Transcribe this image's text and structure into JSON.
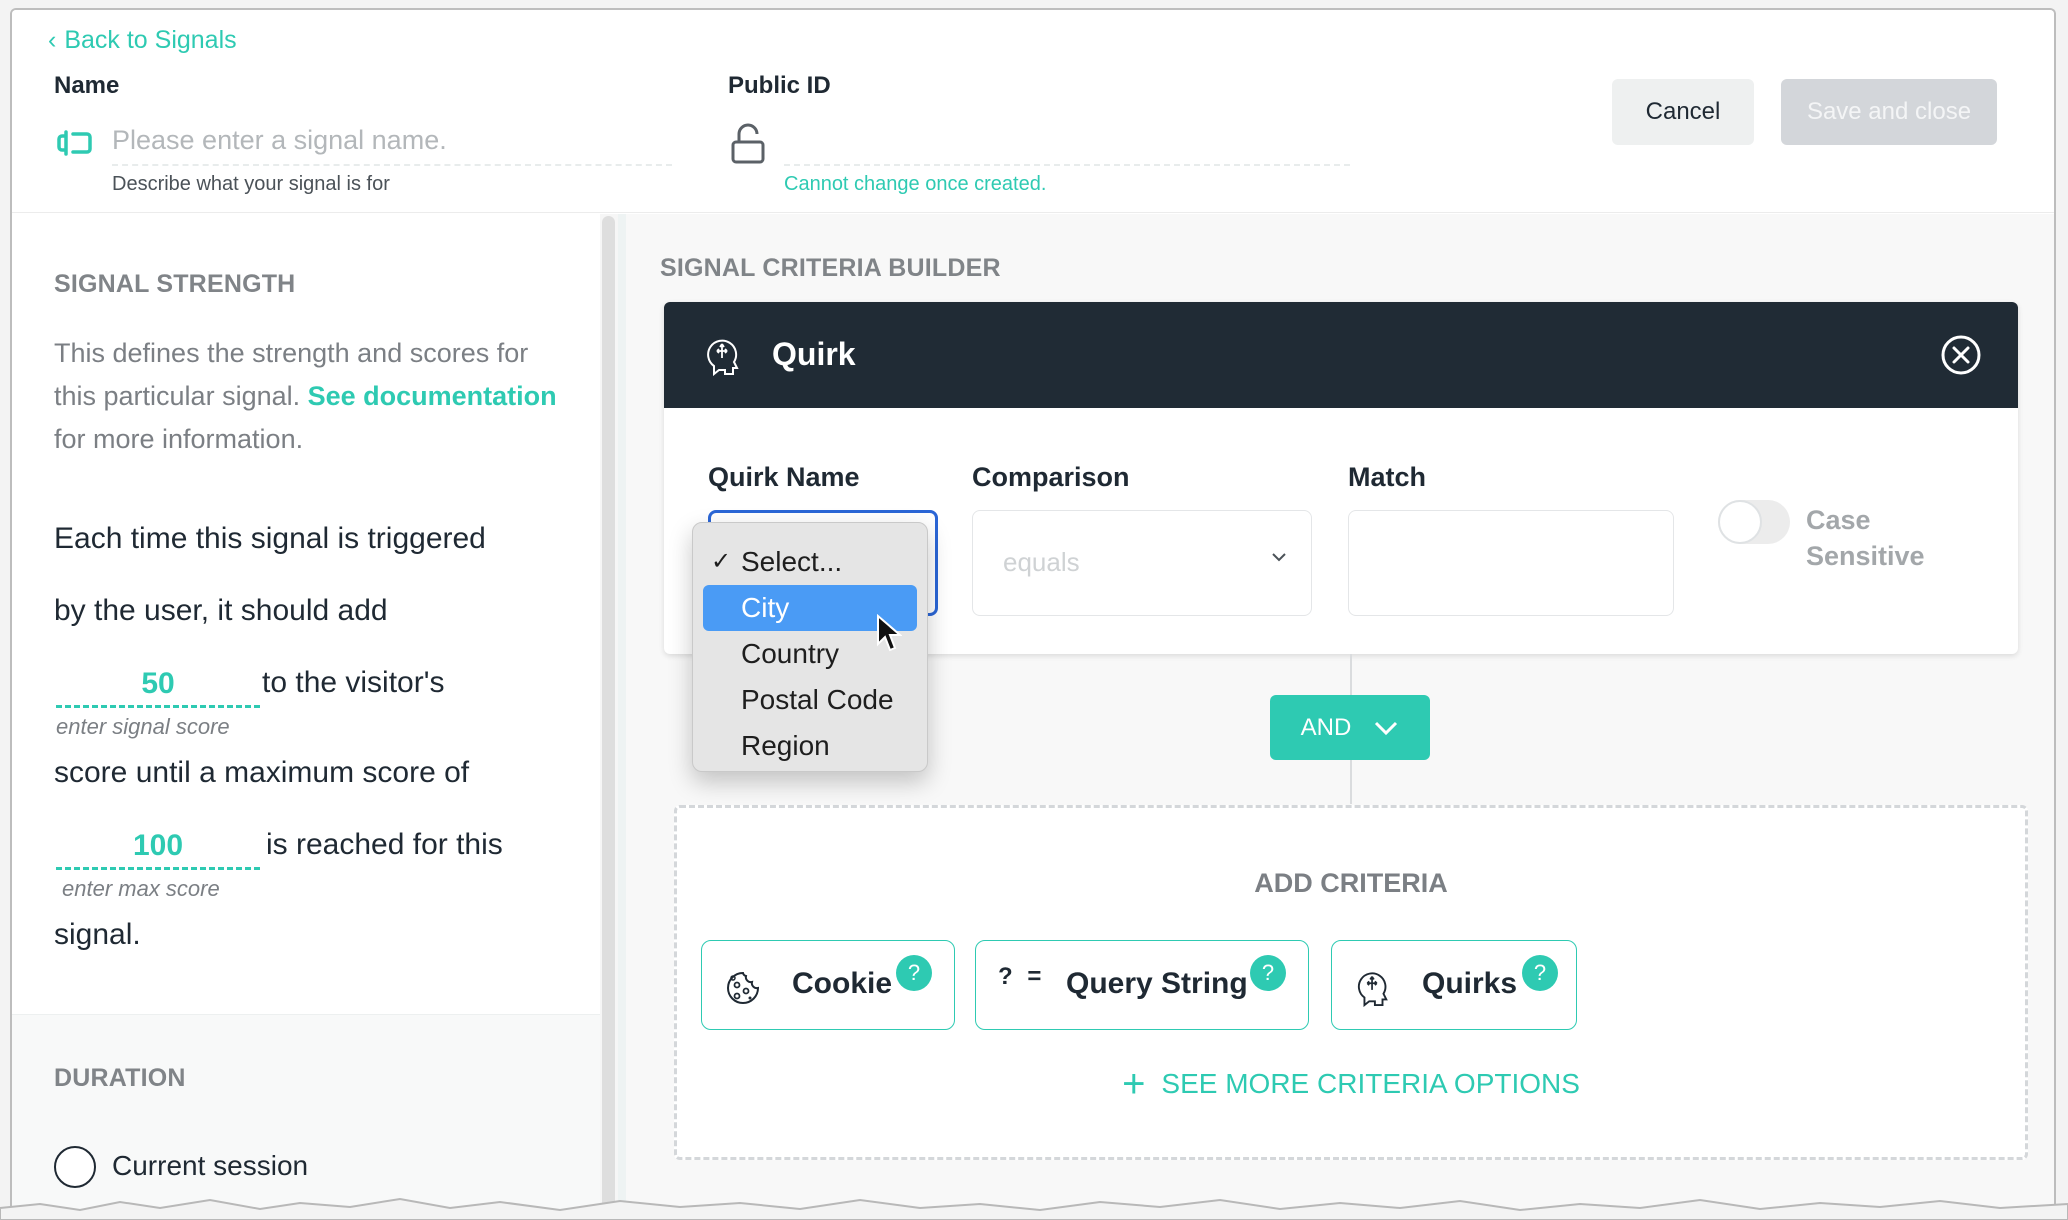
{
  "header": {
    "back_link": "Back to Signals",
    "name_label": "Name",
    "name_placeholder": "Please enter a signal name.",
    "name_value": "",
    "name_help": "Describe what your signal is for",
    "public_id_label": "Public ID",
    "public_id_value": "",
    "public_id_help": "Cannot change once created.",
    "cancel_label": "Cancel",
    "save_label": "Save and close"
  },
  "signal_strength": {
    "title": "SIGNAL STRENGTH",
    "desc_prefix": "This defines the strength and scores for this particular signal. ",
    "desc_link": "See documentation",
    "desc_suffix": " for more information.",
    "line1": "Each time this signal is triggered",
    "line2": "by the user, it should add",
    "score_value": "50",
    "score_caption": "enter signal score",
    "line3_after_score": "to the visitor's",
    "line4": "score until a maximum score of",
    "max_value": "100",
    "max_caption": "enter max score",
    "line5_after_max": "is reached for this",
    "line6": "signal."
  },
  "duration": {
    "title": "DURATION",
    "options": [
      {
        "label": "Current session",
        "selected": false
      }
    ]
  },
  "criteria_builder": {
    "title": "SIGNAL CRITERIA BUILDER",
    "quirk_card": {
      "title": "Quirk",
      "quirk_name_label": "Quirk Name",
      "comparison_label": "Comparison",
      "comparison_value": "equals",
      "match_label": "Match",
      "match_value": "",
      "case_sensitive_label": "Case Sensitive",
      "case_sensitive_on": false
    },
    "quirk_dropdown": {
      "options": [
        {
          "label": "Select...",
          "checked": true,
          "highlighted": false
        },
        {
          "label": "City",
          "checked": false,
          "highlighted": true
        },
        {
          "label": "Country",
          "checked": false,
          "highlighted": false
        },
        {
          "label": "Postal Code",
          "checked": false,
          "highlighted": false
        },
        {
          "label": "Region",
          "checked": false,
          "highlighted": false
        }
      ]
    },
    "operator_label": "AND",
    "add_criteria": {
      "title": "ADD CRITERIA",
      "options": [
        {
          "label": "Cookie",
          "icon": "cookie-icon",
          "help": "?"
        },
        {
          "label": "Query String",
          "icon": "query-string-icon",
          "glyph": "? =",
          "help": "?"
        },
        {
          "label": "Quirks",
          "icon": "quirk-head-icon",
          "help": "?"
        }
      ],
      "see_more_label": "SEE MORE CRITERIA OPTIONS"
    }
  },
  "colors": {
    "accent": "#2ecab2",
    "dark_header": "#202b35",
    "highlight": "#4a9bf5",
    "disabled_button": "#d3d6da"
  }
}
